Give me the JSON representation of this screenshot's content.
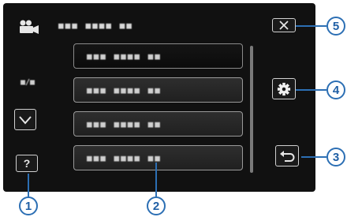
{
  "header": {
    "icon": "video-camera-icon",
    "title": "■■■ ■■■■ ■■"
  },
  "menu": {
    "items": [
      {
        "label": "■■■ ■■■■ ■■"
      },
      {
        "label": "■■■ ■■■■ ■■"
      },
      {
        "label": "■■■ ■■■■ ■■"
      },
      {
        "label": "■■■ ■■■■ ■■"
      }
    ]
  },
  "left_panel": {
    "page_indicator": "■/■",
    "down_icon": "chevron-down-icon",
    "help_label": "?"
  },
  "right_panel": {
    "close_icon": "close-icon",
    "settings_icon": "gear-icon",
    "back_icon": "return-arrow-icon"
  },
  "callouts": [
    "1",
    "2",
    "3",
    "4",
    "5"
  ],
  "colors": {
    "screen_bg": "#111111",
    "accent": "#2c6fb4"
  }
}
